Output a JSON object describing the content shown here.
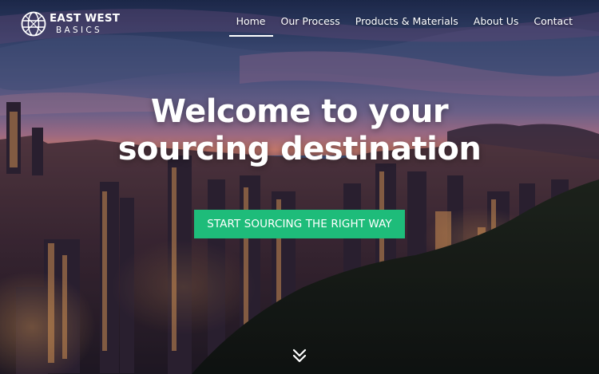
{
  "brand": {
    "logo_icon": "globe-icon",
    "line1": "EAST WEST",
    "line2": "BASICS"
  },
  "nav": {
    "items": [
      {
        "label": "Home",
        "active": true
      },
      {
        "label": "Our Process",
        "active": false
      },
      {
        "label": "Products & Materials",
        "active": false
      },
      {
        "label": "About Us",
        "active": false
      },
      {
        "label": "Contact",
        "active": false
      }
    ]
  },
  "hero": {
    "headline_line1": "Welcome to your",
    "headline_line2": "sourcing destination",
    "cta_label": "START SOURCING THE RIGHT WAY",
    "cta_color": "#1ebc7a",
    "scroll_icon": "double-chevron-down-icon"
  }
}
